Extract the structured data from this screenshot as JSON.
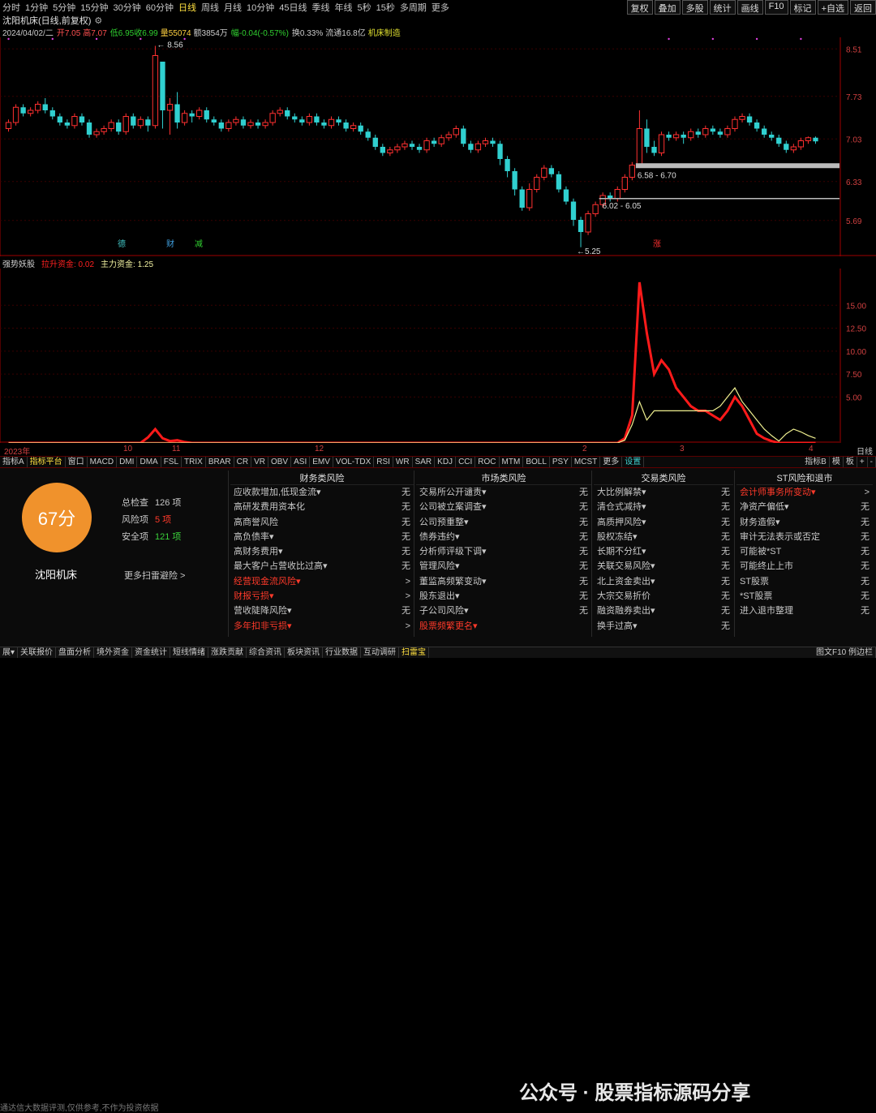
{
  "top_tabs": [
    "分时",
    "1分钟",
    "5分钟",
    "15分钟",
    "30分钟",
    "60分钟",
    "日线",
    "周线",
    "月线",
    "10分钟",
    "45日线",
    "季线",
    "年线",
    "5秒",
    "15秒",
    "多周期",
    "更多"
  ],
  "active_tab": "日线",
  "top_tools": [
    "复权",
    "叠加",
    "多股",
    "统计",
    "画线",
    "F10",
    "标记",
    "+自选",
    "返回"
  ],
  "title": "沈阳机床(日线,前复权)",
  "info": {
    "date": "2024/04/02/二",
    "open": "开7.05",
    "high": "高7.07",
    "low": "低6.95",
    "close": "收6.99",
    "volume": "量55074",
    "amount": "额3854万",
    "change": "幅-0.04(-0.57%)",
    "turnover": "换0.33%",
    "float": "流通16.8亿",
    "industry": "机床制造"
  },
  "price_axis": [
    "8.51",
    "7.73",
    "7.03",
    "6.33",
    "5.69"
  ],
  "annotations": {
    "high": "8.56",
    "low": "5.25",
    "band1": "6.58 - 6.70",
    "band2": "6.02 - 6.05",
    "marks": [
      "德",
      "财",
      "减",
      "涨"
    ]
  },
  "sub_title": {
    "name": "强势妖股",
    "s1": "拉升资金: 0.02",
    "s2": "主力资金: 1.25"
  },
  "sub_axis": [
    "15.00",
    "12.50",
    "10.00",
    "7.50",
    "5.00"
  ],
  "x_axis": [
    "2023年",
    "10",
    "11",
    "12",
    "2",
    "3",
    "4"
  ],
  "x_axis_right": "日线",
  "indicator_tabs": [
    "指标A",
    "指标平台",
    "窗口",
    "MACD",
    "DMI",
    "DMA",
    "FSL",
    "TRIX",
    "BRAR",
    "CR",
    "VR",
    "OBV",
    "ASI",
    "EMV",
    "VOL-TDX",
    "RSI",
    "WR",
    "SAR",
    "KDJ",
    "CCI",
    "ROC",
    "MTM",
    "BOLL",
    "PSY",
    "MCST",
    "更多",
    "设置"
  ],
  "indicator_right": [
    "指标B",
    "模",
    "板",
    "+",
    "-"
  ],
  "score": "67分",
  "stock_name": "沈阳机床",
  "stats": [
    {
      "label": "总检查",
      "value": "126 项",
      "color": "#c8c8c8"
    },
    {
      "label": "风险项",
      "value": "5 项",
      "color": "#ff3a2a"
    },
    {
      "label": "安全项",
      "value": "121 项",
      "color": "#3ad03a"
    }
  ],
  "more_link": "更多扫雷避险 >",
  "columns": [
    {
      "title": "财务类风险",
      "items": [
        [
          "应收款增加,低现金流▾",
          "无",
          false
        ],
        [
          "高研发费用资本化",
          "无",
          false
        ],
        [
          "高商誉风险",
          "无",
          false
        ],
        [
          "高负债率▾",
          "无",
          false
        ],
        [
          "高财务费用▾",
          "无",
          false
        ],
        [
          "最大客户占营收比过高▾",
          "无",
          false
        ],
        [
          "经营现金流风险▾",
          ">",
          true
        ],
        [
          "财报亏损▾",
          ">",
          true
        ],
        [
          "营收陡降风险▾",
          "无",
          false
        ],
        [
          "多年扣非亏损▾",
          ">",
          true
        ]
      ]
    },
    {
      "title": "市场类风险",
      "items": [
        [
          "交易所公开谴责▾",
          "无",
          false
        ],
        [
          "公司被立案调查▾",
          "无",
          false
        ],
        [
          "公司预重整▾",
          "无",
          false
        ],
        [
          "债券违约▾",
          "无",
          false
        ],
        [
          "分析师评级下调▾",
          "无",
          false
        ],
        [
          "管理风险▾",
          "无",
          false
        ],
        [
          "董监高频繁变动▾",
          "无",
          false
        ],
        [
          "股东退出▾",
          "无",
          false
        ],
        [
          "子公司风险▾",
          "无",
          false
        ],
        [
          "股票频繁更名▾",
          "",
          true
        ]
      ]
    },
    {
      "title": "交易类风险",
      "items": [
        [
          "大比例解禁▾",
          "无",
          false
        ],
        [
          "清仓式减持▾",
          "无",
          false
        ],
        [
          "高质押风险▾",
          "无",
          false
        ],
        [
          "股权冻结▾",
          "无",
          false
        ],
        [
          "长期不分红▾",
          "无",
          false
        ],
        [
          "关联交易风险▾",
          "无",
          false
        ],
        [
          "北上资金卖出▾",
          "无",
          false
        ],
        [
          "大宗交易折价",
          "无",
          false
        ],
        [
          "融资融券卖出▾",
          "无",
          false
        ],
        [
          "换手过高▾",
          "无",
          false
        ]
      ]
    },
    {
      "title": "ST风险和退市",
      "items": [
        [
          "会计师事务所变动▾",
          ">",
          true
        ],
        [
          "净资产偏低▾",
          "无",
          false
        ],
        [
          "财务造假▾",
          "无",
          false
        ],
        [
          "审计无法表示或否定",
          "无",
          false
        ],
        [
          "可能被*ST",
          "无",
          false
        ],
        [
          "可能终止上市",
          "无",
          false
        ],
        [
          "ST股票",
          "无",
          false
        ],
        [
          "*ST股票",
          "无",
          false
        ],
        [
          "进入退市整理",
          "无",
          false
        ]
      ]
    }
  ],
  "disclaimer": "通达信大数据评测,仅供参考,不作为投资依据",
  "watermark": "公众号 · 股票指标源码分享",
  "bottom_tabs": [
    "展▾",
    "关联报价",
    "盘面分析",
    "境外资金",
    "资金统计",
    "短线情绪",
    "涨跌贡献",
    "综合资讯",
    "板块资讯",
    "行业数据",
    "互动调研",
    "扫雷宝"
  ],
  "bottom_active": "扫雷宝",
  "bottom_right": "图文F10  例边栏",
  "chart_data": {
    "type": "candlestick",
    "price_ylim": [
      5.1,
      8.7
    ],
    "candles": [
      [
        7.2,
        7.3,
        7.35,
        7.15
      ],
      [
        7.3,
        7.55,
        7.6,
        7.25
      ],
      [
        7.55,
        7.45,
        7.6,
        7.4
      ],
      [
        7.45,
        7.5,
        7.55,
        7.4
      ],
      [
        7.5,
        7.6,
        7.65,
        7.45
      ],
      [
        7.6,
        7.5,
        7.7,
        7.45
      ],
      [
        7.5,
        7.4,
        7.55,
        7.35
      ],
      [
        7.4,
        7.3,
        7.45,
        7.25
      ],
      [
        7.3,
        7.25,
        7.35,
        7.2
      ],
      [
        7.25,
        7.4,
        7.45,
        7.2
      ],
      [
        7.4,
        7.3,
        7.45,
        7.25
      ],
      [
        7.3,
        7.1,
        7.35,
        7.05
      ],
      [
        7.1,
        7.15,
        7.2,
        7.05
      ],
      [
        7.15,
        7.2,
        7.25,
        7.1
      ],
      [
        7.2,
        7.3,
        7.35,
        7.15
      ],
      [
        7.3,
        7.15,
        7.35,
        7.1
      ],
      [
        7.15,
        7.4,
        7.45,
        7.1
      ],
      [
        7.4,
        7.25,
        7.45,
        7.2
      ],
      [
        7.25,
        7.35,
        7.4,
        7.2
      ],
      [
        7.35,
        7.25,
        7.4,
        7.15
      ],
      [
        7.25,
        8.4,
        8.56,
        7.2
      ],
      [
        8.3,
        7.5,
        8.0,
        7.2
      ],
      [
        7.5,
        7.6,
        7.7,
        7.1
      ],
      [
        7.6,
        7.3,
        7.8,
        7.2
      ],
      [
        7.3,
        7.45,
        7.5,
        7.25
      ],
      [
        7.45,
        7.4,
        7.5,
        7.3
      ],
      [
        7.4,
        7.5,
        7.55,
        7.35
      ],
      [
        7.5,
        7.35,
        7.55,
        7.3
      ],
      [
        7.35,
        7.3,
        7.4,
        7.25
      ],
      [
        7.3,
        7.2,
        7.35,
        7.15
      ],
      [
        7.2,
        7.3,
        7.35,
        7.15
      ],
      [
        7.3,
        7.35,
        7.4,
        7.25
      ],
      [
        7.35,
        7.25,
        7.4,
        7.2
      ],
      [
        7.25,
        7.3,
        7.35,
        7.2
      ],
      [
        7.3,
        7.25,
        7.35,
        7.2
      ],
      [
        7.25,
        7.3,
        7.35,
        7.2
      ],
      [
        7.3,
        7.45,
        7.5,
        7.25
      ],
      [
        7.45,
        7.5,
        7.55,
        7.4
      ],
      [
        7.5,
        7.4,
        7.55,
        7.35
      ],
      [
        7.4,
        7.35,
        7.45,
        7.3
      ],
      [
        7.35,
        7.3,
        7.4,
        7.25
      ],
      [
        7.3,
        7.4,
        7.45,
        7.25
      ],
      [
        7.4,
        7.3,
        7.45,
        7.25
      ],
      [
        7.3,
        7.25,
        7.35,
        7.2
      ],
      [
        7.25,
        7.35,
        7.4,
        7.2
      ],
      [
        7.35,
        7.3,
        7.4,
        7.25
      ],
      [
        7.3,
        7.2,
        7.35,
        7.15
      ],
      [
        7.2,
        7.25,
        7.3,
        7.15
      ],
      [
        7.25,
        7.15,
        7.3,
        7.1
      ],
      [
        7.15,
        7.05,
        7.2,
        7.0
      ],
      [
        7.05,
        6.9,
        7.1,
        6.85
      ],
      [
        6.9,
        6.8,
        6.95,
        6.75
      ],
      [
        6.8,
        6.85,
        6.9,
        6.75
      ],
      [
        6.85,
        6.9,
        6.95,
        6.8
      ],
      [
        6.9,
        6.95,
        7.0,
        6.85
      ],
      [
        6.95,
        6.9,
        7.0,
        6.85
      ],
      [
        6.9,
        6.85,
        6.95,
        6.8
      ],
      [
        6.85,
        7.0,
        7.05,
        6.8
      ],
      [
        7.0,
        6.95,
        7.05,
        6.9
      ],
      [
        6.95,
        7.05,
        7.1,
        6.9
      ],
      [
        7.05,
        7.1,
        7.15,
        7.0
      ],
      [
        7.1,
        7.2,
        7.25,
        7.05
      ],
      [
        7.2,
        6.95,
        7.25,
        6.9
      ],
      [
        6.95,
        6.85,
        7.0,
        6.8
      ],
      [
        6.85,
        6.95,
        7.0,
        6.8
      ],
      [
        6.95,
        7.0,
        7.05,
        6.9
      ],
      [
        7.0,
        6.95,
        7.05,
        6.9
      ],
      [
        6.95,
        6.7,
        7.0,
        6.6
      ],
      [
        6.7,
        6.5,
        6.75,
        6.4
      ],
      [
        6.5,
        6.2,
        6.55,
        6.1
      ],
      [
        6.2,
        5.9,
        6.25,
        5.85
      ],
      [
        5.9,
        6.2,
        6.3,
        5.85
      ],
      [
        6.2,
        6.4,
        6.45,
        6.15
      ],
      [
        6.4,
        6.55,
        6.6,
        6.35
      ],
      [
        6.55,
        6.45,
        6.6,
        6.4
      ],
      [
        6.45,
        6.2,
        6.5,
        6.15
      ],
      [
        6.2,
        6.0,
        6.25,
        5.95
      ],
      [
        6.0,
        5.7,
        6.05,
        5.6
      ],
      [
        5.7,
        5.5,
        5.75,
        5.25
      ],
      [
        5.5,
        5.8,
        5.85,
        5.45
      ],
      [
        5.8,
        5.95,
        6.0,
        5.75
      ],
      [
        5.95,
        6.1,
        6.15,
        5.9
      ],
      [
        6.1,
        6.05,
        6.15,
        6.0
      ],
      [
        6.05,
        6.2,
        6.25,
        6.0
      ],
      [
        6.2,
        6.4,
        6.45,
        6.15
      ],
      [
        6.4,
        6.6,
        6.65,
        6.35
      ],
      [
        6.6,
        7.2,
        7.5,
        6.55
      ],
      [
        7.2,
        6.9,
        7.35,
        6.8
      ],
      [
        6.9,
        6.8,
        7.0,
        6.75
      ],
      [
        6.8,
        7.1,
        7.15,
        6.75
      ],
      [
        7.1,
        7.05,
        7.15,
        7.0
      ],
      [
        7.05,
        7.1,
        7.15,
        7.0
      ],
      [
        7.1,
        7.05,
        7.15,
        6.95
      ],
      [
        7.05,
        7.15,
        7.2,
        7.0
      ],
      [
        7.15,
        7.1,
        7.2,
        7.05
      ],
      [
        7.1,
        7.2,
        7.25,
        7.05
      ],
      [
        7.2,
        7.15,
        7.25,
        7.1
      ],
      [
        7.15,
        7.1,
        7.2,
        7.05
      ],
      [
        7.1,
        7.2,
        7.25,
        7.05
      ],
      [
        7.2,
        7.35,
        7.4,
        7.15
      ],
      [
        7.35,
        7.4,
        7.45,
        7.3
      ],
      [
        7.4,
        7.3,
        7.45,
        7.25
      ],
      [
        7.3,
        7.2,
        7.35,
        7.15
      ],
      [
        7.2,
        7.1,
        7.25,
        7.05
      ],
      [
        7.1,
        7.05,
        7.15,
        7.0
      ],
      [
        7.05,
        6.95,
        7.1,
        6.9
      ],
      [
        6.95,
        6.85,
        7.0,
        6.8
      ],
      [
        6.85,
        6.9,
        6.95,
        6.8
      ],
      [
        6.9,
        7.0,
        7.05,
        6.85
      ],
      [
        7.0,
        7.05,
        7.07,
        6.95
      ],
      [
        7.05,
        6.99,
        7.07,
        6.95
      ]
    ],
    "red_series": [
      0,
      0,
      0,
      0,
      0,
      0,
      0,
      0,
      0,
      0,
      0,
      0,
      0,
      0,
      0,
      0,
      0,
      0,
      0,
      0.6,
      1.5,
      0.5,
      0.2,
      0.3,
      0.1,
      0,
      0,
      0,
      0,
      0,
      0,
      0,
      0,
      0,
      0,
      0,
      0,
      0,
      0,
      0,
      0,
      0,
      0,
      0,
      0,
      0,
      0,
      0,
      0,
      0,
      0,
      0,
      0,
      0,
      0,
      0,
      0,
      0,
      0,
      0,
      0,
      0,
      0,
      0,
      0,
      0,
      0,
      0,
      0,
      0,
      0,
      0,
      0,
      0,
      0,
      0,
      0,
      0,
      0,
      0,
      0,
      0,
      0,
      0,
      0.5,
      3,
      17.5,
      12,
      7.5,
      9,
      8,
      6,
      5,
      4,
      3.5,
      3.5,
      3,
      2.5,
      3.5,
      5,
      4,
      2.5,
      1,
      0.5,
      0.2,
      0,
      0,
      0,
      0,
      0,
      0
    ],
    "yellow_series": [
      0,
      0,
      0,
      0,
      0,
      0,
      0,
      0,
      0,
      0,
      0,
      0,
      0,
      0,
      0,
      0,
      0,
      0,
      0,
      0,
      0,
      0,
      0,
      0,
      0,
      0,
      0,
      0,
      0,
      0,
      0,
      0,
      0,
      0,
      0,
      0,
      0,
      0,
      0,
      0,
      0,
      0,
      0,
      0,
      0,
      0,
      0,
      0,
      0,
      0,
      0,
      0,
      0,
      0,
      0,
      0,
      0,
      0,
      0,
      0,
      0,
      0,
      0,
      0,
      0,
      0,
      0,
      0,
      0,
      0,
      0,
      0,
      0,
      0,
      0,
      0,
      0,
      0,
      0,
      0,
      0,
      0,
      0,
      0,
      0.3,
      2,
      4.5,
      2.5,
      3.5,
      3.5,
      3.5,
      3.5,
      3.5,
      3.5,
      3.5,
      3.5,
      3.5,
      4,
      5,
      6,
      4.5,
      3.5,
      2.5,
      1.5,
      0.8,
      0.2,
      1,
      1.5,
      1.2,
      0.8,
      0.5
    ],
    "sub_ylim": [
      0,
      19
    ]
  }
}
